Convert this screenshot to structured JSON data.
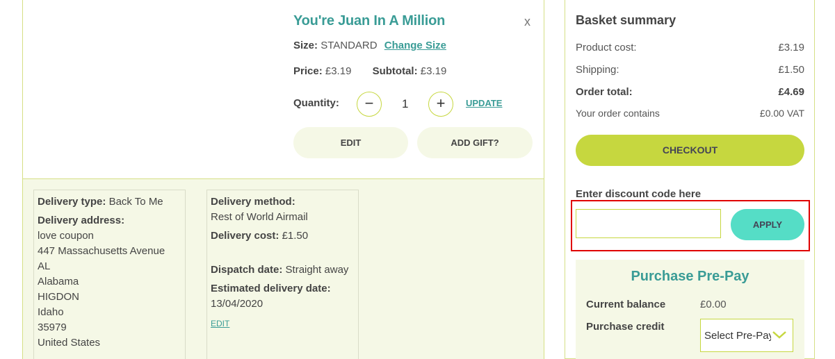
{
  "product": {
    "title": "You're Juan In A Million",
    "close": "x",
    "size_label": "Size:",
    "size_value": "STANDARD",
    "change_size": "Change Size",
    "price_label": "Price:",
    "price_value": "£3.19",
    "subtotal_label": "Subtotal:",
    "subtotal_value": "£3.19",
    "quantity_label": "Quantity:",
    "quantity_value": "1",
    "minus": "−",
    "plus": "+",
    "update": "UPDATE",
    "edit": "EDIT",
    "add_gift": "ADD GIFT?"
  },
  "delivery": {
    "type_label": "Delivery type:",
    "type_value": "Back To Me",
    "address_label": "Delivery address:",
    "address_lines": [
      "love coupon",
      "447 Massachusetts Avenue",
      "AL",
      "Alabama",
      "HIGDON",
      "Idaho",
      "35979",
      "United States"
    ],
    "method_label": "Delivery method:",
    "method_value": "Rest of World Airmail",
    "cost_label": "Delivery cost:",
    "cost_value": "£1.50",
    "dispatch_label": "Dispatch date:",
    "dispatch_value": "Straight away",
    "estimated_label": "Estimated delivery date:",
    "estimated_value": "13/04/2020",
    "edit": "EDIT"
  },
  "basket": {
    "title": "Basket summary",
    "rows": [
      {
        "label": "Product cost:",
        "value": "£3.19"
      },
      {
        "label": "Shipping:",
        "value": "£1.50"
      },
      {
        "label": "Order total:",
        "value": "£4.69"
      },
      {
        "label": "Your order contains",
        "value": "£0.00 VAT"
      }
    ],
    "checkout": "CHECKOUT",
    "discount_label": "Enter discount code here",
    "discount_value": "",
    "apply": "APPLY"
  },
  "prepay": {
    "title": "Purchase Pre-Pay",
    "balance_label": "Current balance",
    "balance_value": "£0.00",
    "credit_label": "Purchase credit",
    "select_value": "Select Pre-Pay"
  },
  "colors": {
    "accent_teal": "#3a9c96",
    "lime": "#c6d73f",
    "apply_cyan": "#55ddc6",
    "highlight_red": "#e00000"
  }
}
